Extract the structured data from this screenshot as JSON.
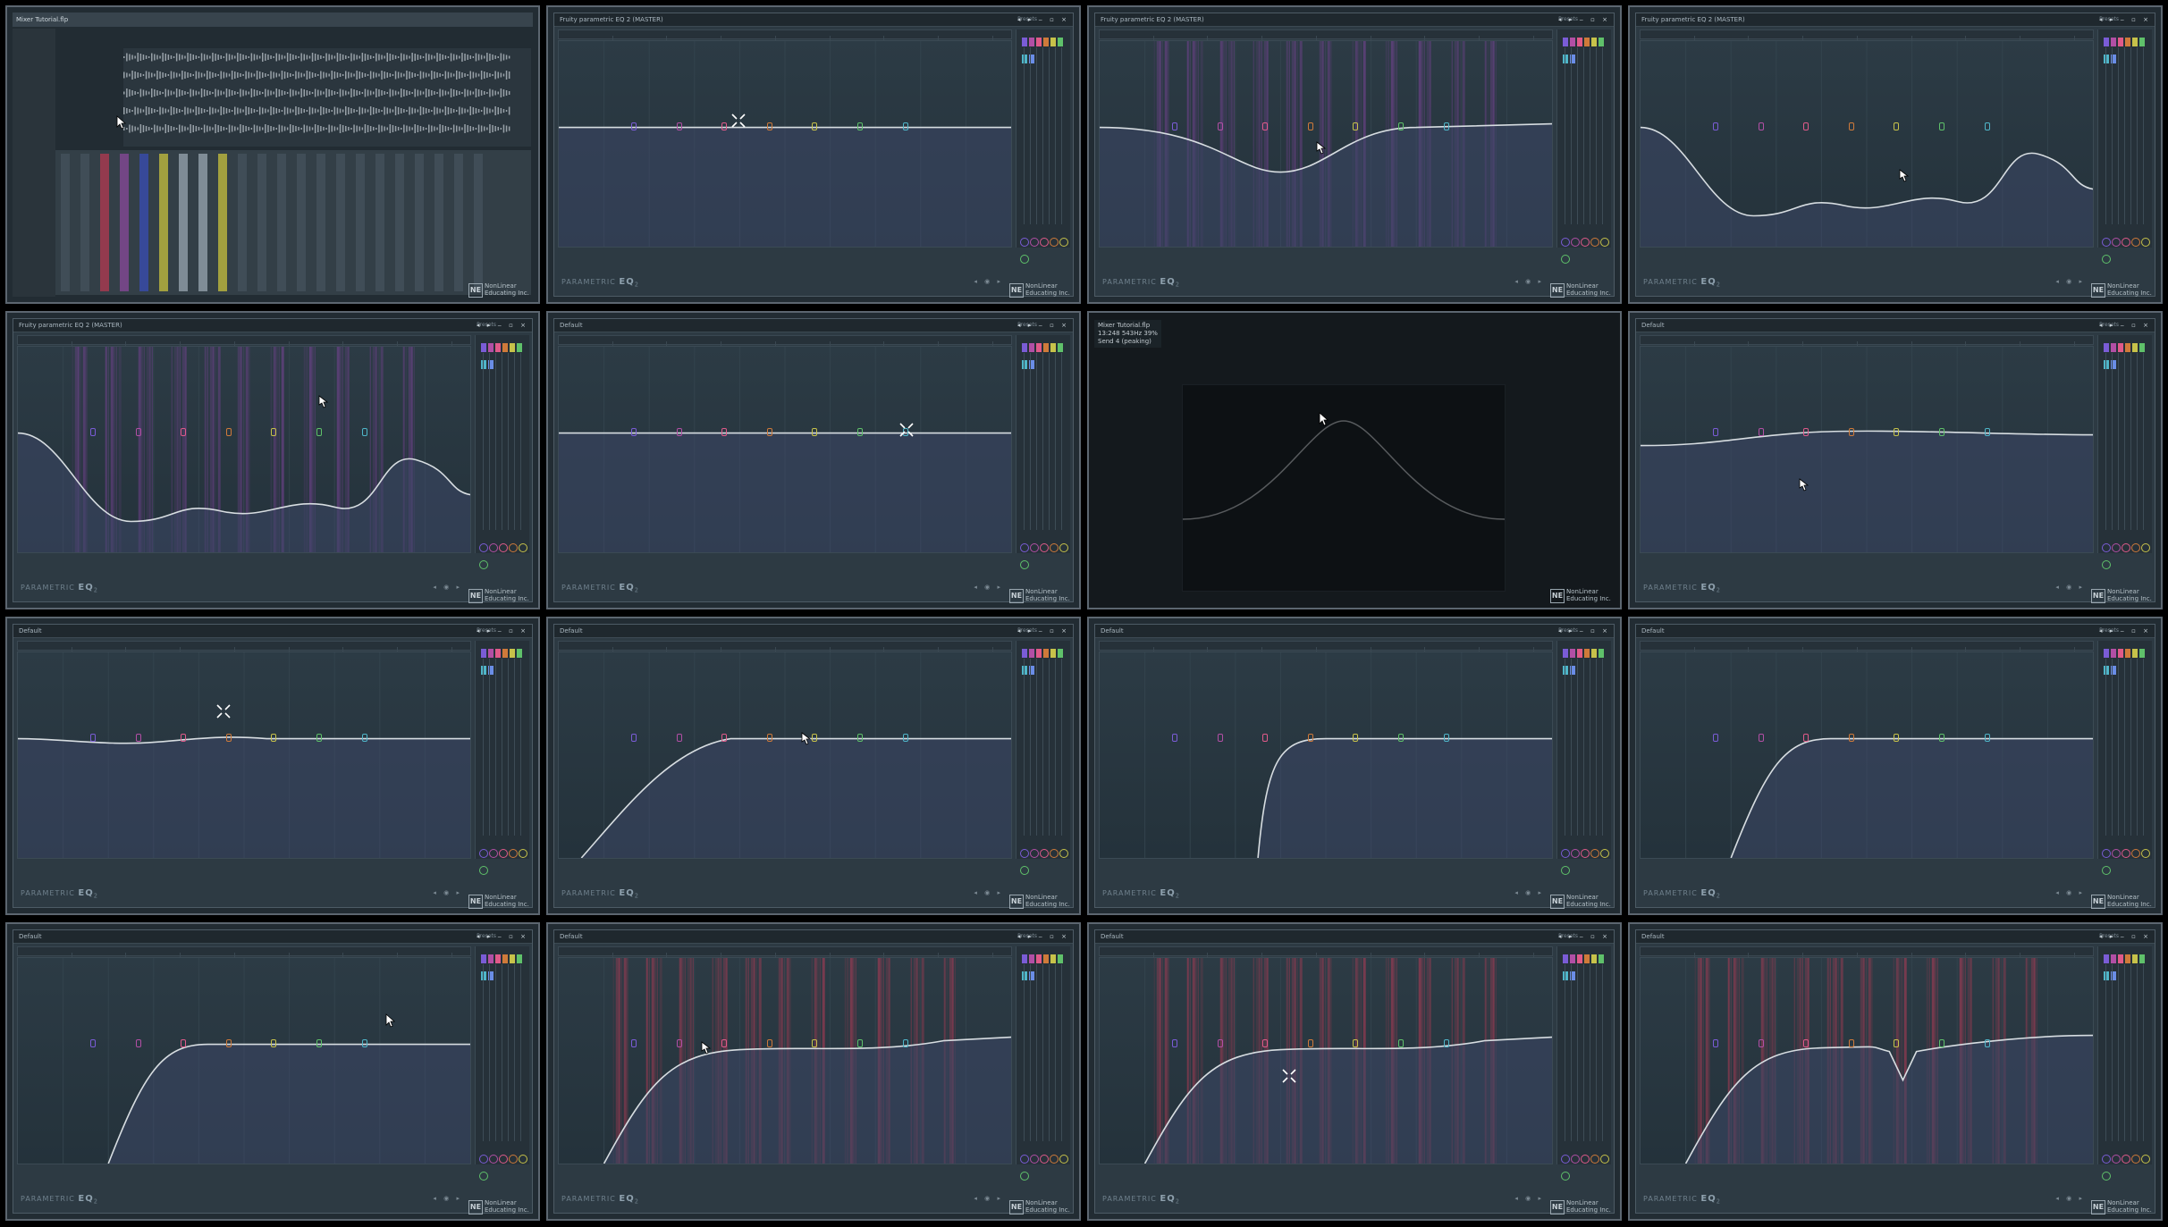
{
  "layout": {
    "columns": 4,
    "rows": 4
  },
  "common": {
    "plugin_logo_prefix": "PARAMETRIC",
    "plugin_logo_suffix": "EQ",
    "plugin_logo_num": "2",
    "preset_label": "Presets",
    "window_controls": "◂ ▸ ‒ ▫ ×",
    "watermark_logo": "NE",
    "watermark_line1": "NonLinear",
    "watermark_line2": "Educating Inc.",
    "transport_glyphs": "◂ ◉ ▸",
    "colors": {
      "background": "#000000",
      "tile_border": "#5c6670",
      "window": "#2d3a43",
      "curve": "#d7dde1",
      "fill": "#3c4766"
    },
    "band_swatch_colors": [
      "#7a5cd6",
      "#b24fa5",
      "#e05a8a",
      "#cf7a3a",
      "#c7c24a",
      "#5fc16a",
      "#4fb6c9",
      "#6a8de6"
    ]
  },
  "tiles": [
    {
      "id": 1,
      "kind": "daw",
      "title": "Mixer Tutorial.flp",
      "cursor": "arrow"
    },
    {
      "id": 2,
      "kind": "eq",
      "title": "Fruity parametric EQ 2 (MASTER)",
      "curve": "flat",
      "spectrum": "none",
      "cursor": "cross"
    },
    {
      "id": 3,
      "kind": "eq",
      "title": "Fruity parametric EQ 2 (MASTER)",
      "curve": "dip",
      "spectrum": "purple",
      "cursor": "hand"
    },
    {
      "id": 4,
      "kind": "eq",
      "title": "Fruity parametric EQ 2 (MASTER)",
      "curve": "wavy",
      "spectrum": "none",
      "cursor": "hand"
    },
    {
      "id": 5,
      "kind": "eq",
      "title": "Fruity parametric EQ 2 (MASTER)",
      "curve": "wavy",
      "spectrum": "purple",
      "cursor": "hand"
    },
    {
      "id": 6,
      "kind": "eq",
      "title": "Default",
      "curve": "flat",
      "spectrum": "none",
      "cursor": "cross"
    },
    {
      "id": 7,
      "kind": "dimmed",
      "title": "Mixer Tutorial.flp",
      "info1": "13:248  543Hz  39%",
      "info2": "Send 4 (peaking)",
      "cursor": "arrow"
    },
    {
      "id": 8,
      "kind": "eq",
      "title": "Default",
      "curve": "gentle",
      "spectrum": "none",
      "cursor": "hand"
    },
    {
      "id": 9,
      "kind": "eq",
      "title": "Default",
      "curve": "slightdip",
      "spectrum": "none",
      "cursor": "cross"
    },
    {
      "id": 10,
      "kind": "eq",
      "title": "Default",
      "curve": "hpf_soft",
      "spectrum": "none",
      "cursor": "hand"
    },
    {
      "id": 11,
      "kind": "eq",
      "title": "Default",
      "curve": "hpf_steep",
      "spectrum": "none",
      "cursor": "none"
    },
    {
      "id": 12,
      "kind": "eq",
      "title": "Default",
      "curve": "hpf_mid",
      "spectrum": "none",
      "cursor": "none"
    },
    {
      "id": 13,
      "kind": "eq",
      "title": "Default",
      "curve": "hpf_mid",
      "spectrum": "none",
      "cursor": "arrow"
    },
    {
      "id": 14,
      "kind": "eq",
      "title": "Default",
      "curve": "hpf_shelf",
      "spectrum": "red",
      "cursor": "hand"
    },
    {
      "id": 15,
      "kind": "eq",
      "title": "Default",
      "curve": "hpf_shelf",
      "spectrum": "red",
      "cursor": "cross"
    },
    {
      "id": 16,
      "kind": "eq",
      "title": "Default",
      "curve": "hpf_notch",
      "spectrum": "red",
      "cursor": "none"
    }
  ]
}
